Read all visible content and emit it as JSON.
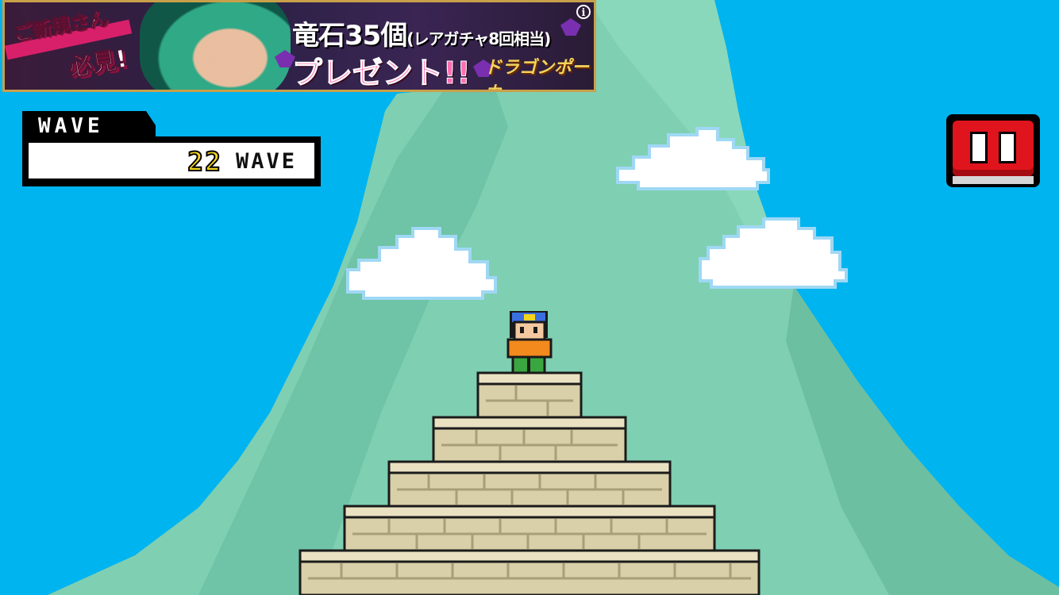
{
  "ad": {
    "tag_line1": "ご新規さん",
    "tag_line2": "必見!",
    "headline": "竜石35個",
    "headline_note": "(レアガチャ8回相当)",
    "subline": "プレゼント!!",
    "logo_text": "ドラゴンポーカー",
    "info_icon": "i"
  },
  "hud": {
    "wave_label": "WAVE",
    "wave_number": "22",
    "wave_unit": "WAVE"
  },
  "icons": {
    "pause": "pause-icon",
    "info": "info-icon"
  },
  "colors": {
    "sky": "#00b4f0",
    "mountain": "#7fcfb2",
    "cloud": "#ffffff",
    "brick": "#d9cfa8",
    "pause_red": "#e0141c",
    "wave_digits": "#f4d51c"
  }
}
